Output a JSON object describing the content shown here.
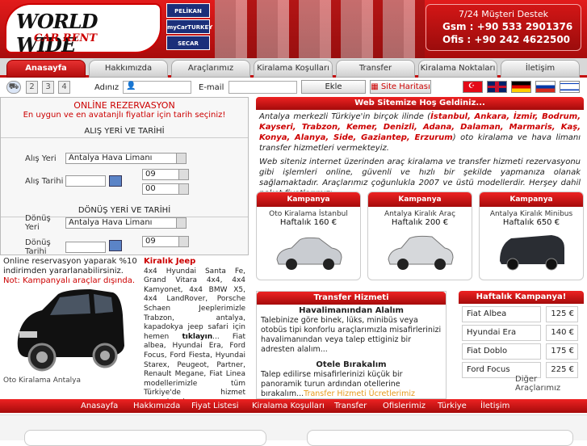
{
  "header": {
    "logo_line1": "WORLD WIDE",
    "logo_line2": "CAR RENT",
    "partners": [
      "PELİKAN",
      "myCarTURKEY",
      "SECAR"
    ],
    "support_title": "7/24 Müşteri Destek",
    "gsm_label": "Gsm",
    "gsm": "+90 533 2901376",
    "ofis_label": "Ofis",
    "ofis": "+90 242 4622500"
  },
  "tabs": [
    "Anasayfa",
    "Hakkımızda",
    "Araçlarımız",
    "Kiralama Koşulları",
    "Transfer",
    "Kiralama Noktaları",
    "İletişim"
  ],
  "toolbar": {
    "pages": [
      "2",
      "3",
      "4"
    ],
    "name_label": "Adınız",
    "email_label": "E-mail",
    "submit": "Ekle",
    "sitemap": "Site Haritası"
  },
  "reservation": {
    "title": "ONLİNE REZERVASYON",
    "subtitle": "En uygun ve en avatanjlı fiyatlar için tarih seçiniz!",
    "pickup_section": "ALIŞ YERİ VE TARİHİ",
    "pickup_place_label": "Alış Yeri",
    "pickup_place": "Antalya Hava Limanı",
    "pickup_date_label": "Alış Tarihi",
    "pickup_hour": "09",
    "pickup_min": "00",
    "return_section": "DÖNÜŞ YERİ VE TARİHİ",
    "return_place_label1": "Dönüş",
    "return_place_label2": "Yeri",
    "return_place": "Antalya Hava Limanı",
    "return_date_label1": "Dönüş",
    "return_date_label2": "Tarihi",
    "return_hour": "09"
  },
  "promo": {
    "line1": "Online reservasyon yaparak %10 indirimden yararlanabilirsiniz.",
    "line2": "Not: Kampanyalı araçlar dışında.",
    "caption": "Oto Kiralama Antalya",
    "jeep_title": "Kiralık Jeep",
    "jeep_text": "4x4 Hyundai Santa Fe, Grand Vitara 4x4, 4x4 Kamyonet, 4x4 BMW X5, 4x4 LandRover, Porsche Schaen Jeeplerimizle Trabzon, antalya, kapadokya jeep safari için hemen",
    "jeep_link": "tıklayın",
    "jeep_text2": "... Fiat albea, Hyundai Era, Ford Focus, Ford Fiesta, Hyundai Starex, Peugeot, Partner, Renault Megane, Fiat Linea modellerimizle tüm Türkiye'de hizmet vermekteyiz."
  },
  "welcome": {
    "title": "Web Sitemize Hoş Geldiniz...",
    "p1_start": "Antalya merkezli Türkiye'in birçok ilinde (",
    "cities": "İstanbul, Ankara, İzmir, Bodrum, Kayseri, Trabzon, Kemer, Denizli, Adana, Dalaman, Marmaris, Kaş, Konya, Alanya, Side, Gaziantep, Erzurum",
    "p1_end": ") oto kiralama ve hava limanı transfer hizmetleri vermekteyiz.",
    "p2": "Web siteniz internet üzerinden araç kiralama ve transfer hizmeti rezervasyonu gibi işlemleri online, güvenli ve hızlı bir şekilde yapmanıza olanak sağlamaktadır. Araçlarımız çoğunlukla 2007 ve üstü modellerdir. Herşey dahil paket fiyatlarımızı ..."
  },
  "campaigns": [
    {
      "head": "Kampanya",
      "title": "Oto Kiralama İstanbul",
      "price": "Haftalık 160 €",
      "color": "#c9ccd1"
    },
    {
      "head": "Kampanya",
      "title": "Antalya Kiralık Araç",
      "price": "Haftalık 200 €",
      "color": "#d6d8db"
    },
    {
      "head": "Kampanya",
      "title": "Antalya Kiralık Minibus",
      "price": "Haftalık 650 €",
      "color": "#2a2d33"
    }
  ],
  "transfer": {
    "title": "Transfer Hizmeti",
    "h1": "Havalimanından Alalım",
    "p1": "Talebinize göre binek, lüks, minibüs veya otobüs tipi konforlu araçlarımızla misafirlerinizi havalimanından veya talep ettiginiz bir adresten alalım...",
    "h2": "Otele Bırakalım",
    "p2": "Talep edilirse misafirlerinizi küçük bir panoramik turun ardından otellerine bırakalım...",
    "link": "Transfer Hizmeti Ücretlerimiz"
  },
  "weekly": {
    "title": "Haftalık Kampanya!",
    "items": [
      {
        "name": "Fiat Albea",
        "price": "125 €"
      },
      {
        "name": "Hyundai Era",
        "price": "140 €"
      },
      {
        "name": "Fiat Doblo",
        "price": "175 €"
      },
      {
        "name": "Ford Focus",
        "price": "225 €"
      }
    ],
    "more": "Diğer Araçlarımız"
  },
  "footer": [
    "Anasayfa",
    "Hakkımızda",
    "Fiyat Listesi",
    "Kiralama Koşulları",
    "Transfer",
    "Ofislerimiz",
    "Türkiye",
    "İletişim"
  ]
}
